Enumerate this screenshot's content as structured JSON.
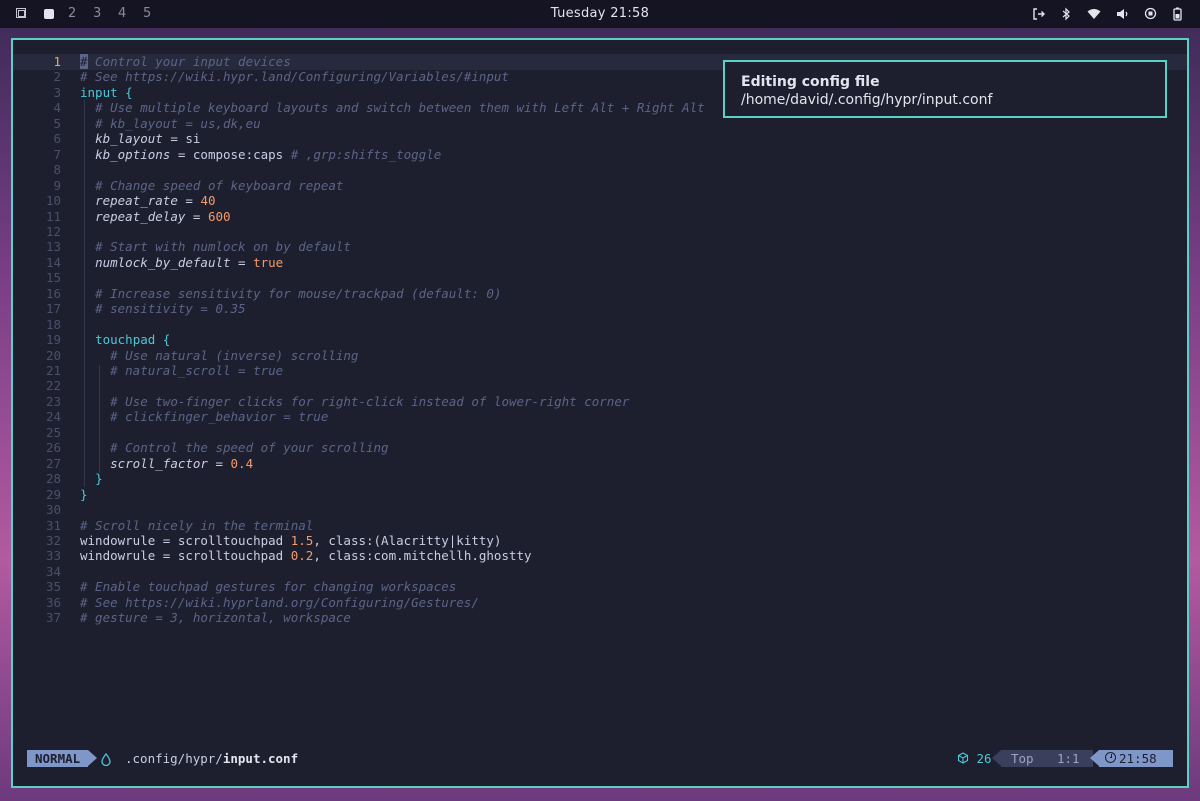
{
  "topbar": {
    "workspaces": [
      "2",
      "3",
      "4",
      "5"
    ],
    "clock": "Tuesday 21:58",
    "tray_icons": [
      "logout-icon",
      "bluetooth-icon",
      "wifi-icon",
      "volume-icon",
      "cpu-icon",
      "battery-icon"
    ]
  },
  "notification": {
    "title": "Editing config file",
    "body": "/home/david/.config/hypr/input.conf"
  },
  "editor": {
    "current_line": 1,
    "lines": [
      {
        "n": "1",
        "t": "# Control your input devices"
      },
      {
        "n": "2",
        "t": "# See https://wiki.hypr.land/Configuring/Variables/#input"
      },
      {
        "n": "3",
        "t": "input {"
      },
      {
        "n": "4",
        "t": "  # Use multiple keyboard layouts and switch between them with Left Alt + Right Alt"
      },
      {
        "n": "5",
        "t": "  # kb_layout = us,dk,eu"
      },
      {
        "n": "6",
        "t": "  kb_layout = si"
      },
      {
        "n": "7",
        "t": "  kb_options = compose:caps # ,grp:shifts_toggle"
      },
      {
        "n": "8",
        "t": ""
      },
      {
        "n": "9",
        "t": "  # Change speed of keyboard repeat"
      },
      {
        "n": "10",
        "t": "  repeat_rate = 40"
      },
      {
        "n": "11",
        "t": "  repeat_delay = 600"
      },
      {
        "n": "12",
        "t": ""
      },
      {
        "n": "13",
        "t": "  # Start with numlock on by default"
      },
      {
        "n": "14",
        "t": "  numlock_by_default = true"
      },
      {
        "n": "15",
        "t": ""
      },
      {
        "n": "16",
        "t": "  # Increase sensitivity for mouse/trackpad (default: 0)"
      },
      {
        "n": "17",
        "t": "  # sensitivity = 0.35"
      },
      {
        "n": "18",
        "t": ""
      },
      {
        "n": "19",
        "t": "  touchpad {"
      },
      {
        "n": "20",
        "t": "    # Use natural (inverse) scrolling"
      },
      {
        "n": "21",
        "t": "    # natural_scroll = true"
      },
      {
        "n": "22",
        "t": ""
      },
      {
        "n": "23",
        "t": "    # Use two-finger clicks for right-click instead of lower-right corner"
      },
      {
        "n": "24",
        "t": "    # clickfinger_behavior = true"
      },
      {
        "n": "25",
        "t": ""
      },
      {
        "n": "26",
        "t": "    # Control the speed of your scrolling"
      },
      {
        "n": "27",
        "t": "    scroll_factor = 0.4"
      },
      {
        "n": "28",
        "t": "  }"
      },
      {
        "n": "29",
        "t": "}"
      },
      {
        "n": "30",
        "t": ""
      },
      {
        "n": "31",
        "t": "# Scroll nicely in the terminal"
      },
      {
        "n": "32",
        "t": "windowrule = scrolltouchpad 1.5, class:(Alacritty|kitty)"
      },
      {
        "n": "33",
        "t": "windowrule = scrolltouchpad 0.2, class:com.mitchellh.ghostty"
      },
      {
        "n": "34",
        "t": ""
      },
      {
        "n": "35",
        "t": "# Enable touchpad gestures for changing workspaces"
      },
      {
        "n": "36",
        "t": "# See https://wiki.hyprland.org/Configuring/Gestures/"
      },
      {
        "n": "37",
        "t": "# gesture = 3, horizontal, workspace"
      }
    ]
  },
  "statusline": {
    "mode": "NORMAL",
    "path_dir": ".config/hypr/",
    "path_file": "input.conf",
    "package_count": "26",
    "scroll_pos": "Top",
    "cursor_pos": "1:1",
    "time": "21:58"
  },
  "colors": {
    "accent": "#5ad1c4",
    "background": "#1d1f2e",
    "comment": "#5c6488",
    "keyword": "#4dc6d6",
    "number": "#f59a6c",
    "mode_bg": "#7f96c8"
  }
}
